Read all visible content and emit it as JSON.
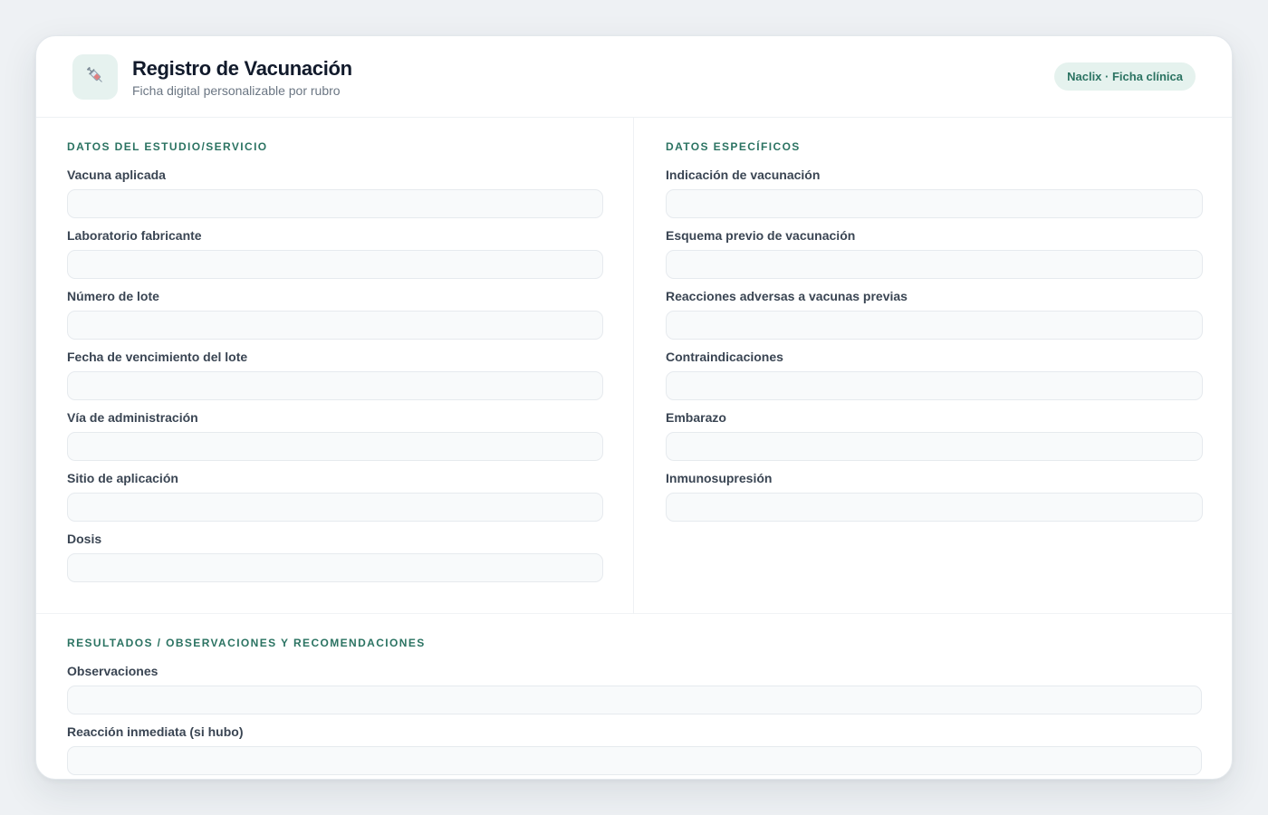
{
  "header": {
    "icon": "syringe-icon",
    "title": "Registro de Vacunación",
    "subtitle": "Ficha digital personalizable por rubro",
    "badge": "Naclix · Ficha clínica"
  },
  "left_section": {
    "title": "DATOS DEL ESTUDIO/SERVICIO",
    "fields": [
      {
        "label": "Vacuna aplicada",
        "value": ""
      },
      {
        "label": "Laboratorio fabricante",
        "value": ""
      },
      {
        "label": "Número de lote",
        "value": ""
      },
      {
        "label": "Fecha de vencimiento del lote",
        "value": ""
      },
      {
        "label": "Vía de administración",
        "value": ""
      },
      {
        "label": "Sitio de aplicación",
        "value": ""
      },
      {
        "label": "Dosis",
        "value": ""
      }
    ]
  },
  "right_section": {
    "title": "DATOS ESPECÍFICOS",
    "fields": [
      {
        "label": "Indicación de vacunación",
        "value": ""
      },
      {
        "label": "Esquema previo de vacunación",
        "value": ""
      },
      {
        "label": "Reacciones adversas a vacunas previas",
        "value": ""
      },
      {
        "label": "Contraindicaciones",
        "value": ""
      },
      {
        "label": "Embarazo",
        "value": ""
      },
      {
        "label": "Inmunosupresión",
        "value": ""
      }
    ]
  },
  "bottom_section": {
    "title": "RESULTADOS / OBSERVACIONES Y RECOMENDACIONES",
    "fields": [
      {
        "label": "Observaciones",
        "value": ""
      },
      {
        "label": "Reacción inmediata (si hubo)",
        "value": ""
      }
    ]
  },
  "colors": {
    "accent": "#2b7362",
    "badge_bg": "#e5f2ee",
    "input_bg": "#f8fafb",
    "input_border": "#e6eaee"
  }
}
